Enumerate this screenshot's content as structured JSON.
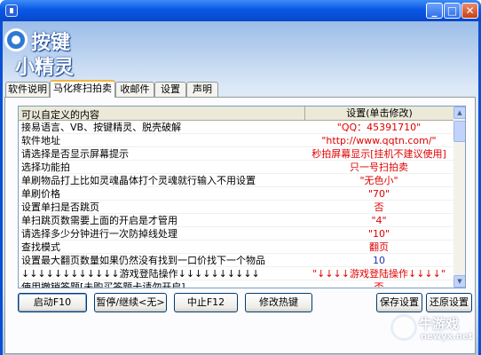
{
  "window": {
    "minimize_label": "_",
    "maximize_label": "□",
    "close_label": "✕"
  },
  "logo": {
    "line1": "按键",
    "line2": "小精灵"
  },
  "tabs": [
    {
      "label": "软件说明"
    },
    {
      "label": "马化疼扫拍卖"
    },
    {
      "label": "收邮件"
    },
    {
      "label": "设置"
    },
    {
      "label": "声明"
    }
  ],
  "active_tab": "马化疼扫拍卖",
  "grid": {
    "header_name": "可以自定义的内容",
    "header_value": "设置(单击修改)",
    "rows": [
      {
        "name": "接易语言、VB、按键精灵、脱壳破解",
        "value": "\"QQ：45391710\""
      },
      {
        "name": "软件地址",
        "value": "\"http://www.qqtn.com/\""
      },
      {
        "name": "请选择是否显示屏幕提示",
        "value": "秒拍屏幕显示[挂机不建议使用]"
      },
      {
        "name": "选择功能拍",
        "value": "只一号扫拍卖"
      },
      {
        "name": "单刷物品打上比如灵魂晶体打个灵魂就行输入不用设置",
        "value": "\"无色小\""
      },
      {
        "name": "单刷价格",
        "value": "\"70\""
      },
      {
        "name": "设置单扫是否跳页",
        "value": "否"
      },
      {
        "name": "单扫跳页数需要上面的开启是才管用",
        "value": "\"4\""
      },
      {
        "name": "请选择多少分钟进行一次防掉线处理",
        "value": "\"10\""
      },
      {
        "name": "查找模式",
        "value": "翻页"
      },
      {
        "name": "设置最大翻页数量如果仍然没有找到一口价找下一个物品",
        "value": "10"
      },
      {
        "name": "↓↓↓↓↓↓↓↓↓↓↓↓游戏登陆操作↓↓↓↓↓↓↓↓↓↓",
        "value": "\"↓↓↓↓游戏登陆操作↓↓↓↓\""
      },
      {
        "name": "使用撤销答题[未购买答题卡请勿开启]",
        "value": "否"
      }
    ]
  },
  "scrollbar": {
    "up": "▲",
    "down": "▼"
  },
  "buttons": {
    "start": "启动F10",
    "pause": "暂停/继续<无>",
    "stop": "中止F12",
    "hotkey": "修改热键",
    "save": "保存设置",
    "restore": "还原设置"
  },
  "watermark": {
    "text": "牛游戏",
    "url": "newyx.net"
  },
  "colors": {
    "titlebar": "#0a58e6",
    "value_text": "#e00000",
    "tab_highlight": "#f3b33d"
  }
}
